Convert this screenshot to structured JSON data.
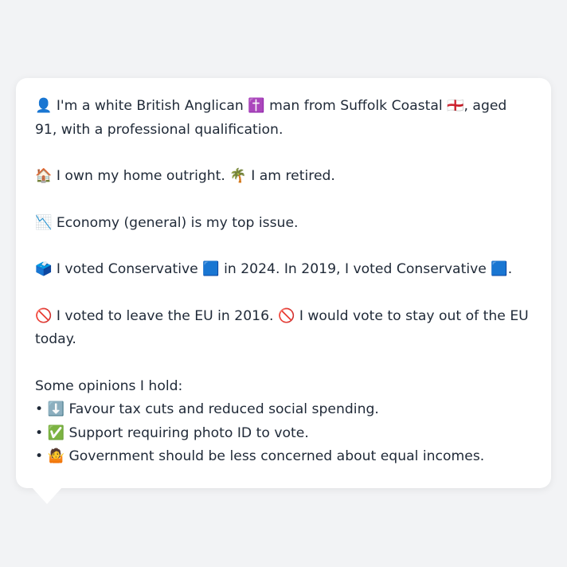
{
  "persona": {
    "identity": "👤 I'm a white British Anglican ✝️ man from Suffolk Coastal 🏴󠁧󠁢󠁥󠁮󠁧󠁿, aged 91, with a professional qualification.",
    "housing": "🏠 I own my home outright. 🌴 I am retired.",
    "top_issue": "📉 Economy (general) is my top issue.",
    "voting": "🗳️ I voted Conservative 🟦 in 2024. In 2019, I voted Conservative 🟦.",
    "eu": "🚫 I voted to leave the EU in 2016. 🚫 I would vote to stay out of the EU today.",
    "opinions_heading": "Some opinions I hold:",
    "opinions": [
      "• ⬇️ Favour tax cuts and reduced social spending.",
      "• ✅ Support requiring photo ID to vote.",
      "• 🤷 Government should be less concerned about equal incomes."
    ]
  }
}
